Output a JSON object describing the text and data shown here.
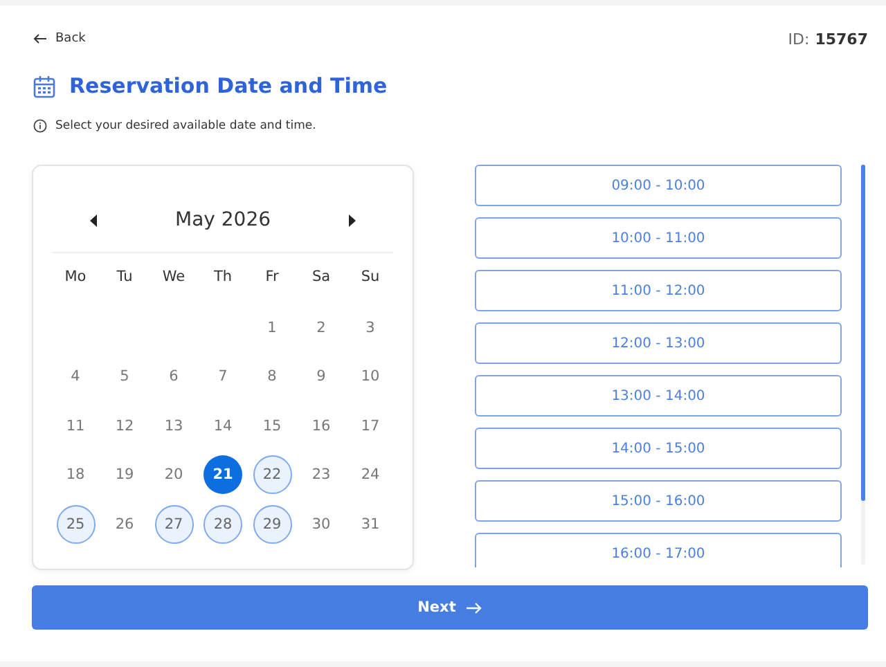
{
  "header": {
    "back": "Back",
    "id_label": "ID:",
    "id_value": "15767"
  },
  "title": "Reservation Date and Time",
  "info": "Select your desired available date and time.",
  "calendar": {
    "month": "May 2026",
    "weekdays": [
      "Mo",
      "Tu",
      "We",
      "Th",
      "Fr",
      "Sa",
      "Su"
    ],
    "weeks": [
      [
        {
          "kind": "blank"
        },
        {
          "kind": "blank"
        },
        {
          "kind": "blank"
        },
        {
          "kind": "blank"
        },
        {
          "kind": "day",
          "label": "1",
          "available": false,
          "selected": false
        },
        {
          "kind": "day",
          "label": "2",
          "available": false,
          "selected": false
        },
        {
          "kind": "day",
          "label": "3",
          "available": false,
          "selected": false
        }
      ],
      [
        {
          "kind": "day",
          "label": "4",
          "available": false,
          "selected": false
        },
        {
          "kind": "day",
          "label": "5",
          "available": false,
          "selected": false
        },
        {
          "kind": "day",
          "label": "6",
          "available": false,
          "selected": false
        },
        {
          "kind": "day",
          "label": "7",
          "available": false,
          "selected": false
        },
        {
          "kind": "day",
          "label": "8",
          "available": false,
          "selected": false
        },
        {
          "kind": "day",
          "label": "9",
          "available": false,
          "selected": false
        },
        {
          "kind": "day",
          "label": "10",
          "available": false,
          "selected": false
        }
      ],
      [
        {
          "kind": "day",
          "label": "11",
          "available": false,
          "selected": false
        },
        {
          "kind": "day",
          "label": "12",
          "available": false,
          "selected": false
        },
        {
          "kind": "day",
          "label": "13",
          "available": false,
          "selected": false
        },
        {
          "kind": "day",
          "label": "14",
          "available": false,
          "selected": false
        },
        {
          "kind": "day",
          "label": "15",
          "available": false,
          "selected": false
        },
        {
          "kind": "day",
          "label": "16",
          "available": false,
          "selected": false
        },
        {
          "kind": "day",
          "label": "17",
          "available": false,
          "selected": false
        }
      ],
      [
        {
          "kind": "day",
          "label": "18",
          "available": false,
          "selected": false
        },
        {
          "kind": "day",
          "label": "19",
          "available": false,
          "selected": false
        },
        {
          "kind": "day",
          "label": "20",
          "available": false,
          "selected": false
        },
        {
          "kind": "day",
          "label": "21",
          "available": true,
          "selected": true
        },
        {
          "kind": "day",
          "label": "22",
          "available": true,
          "selected": false
        },
        {
          "kind": "day",
          "label": "23",
          "available": false,
          "selected": false
        },
        {
          "kind": "day",
          "label": "24",
          "available": false,
          "selected": false
        }
      ],
      [
        {
          "kind": "day",
          "label": "25",
          "available": true,
          "selected": false
        },
        {
          "kind": "day",
          "label": "26",
          "available": false,
          "selected": false
        },
        {
          "kind": "day",
          "label": "27",
          "available": true,
          "selected": false
        },
        {
          "kind": "day",
          "label": "28",
          "available": true,
          "selected": false
        },
        {
          "kind": "day",
          "label": "29",
          "available": true,
          "selected": false
        },
        {
          "kind": "day",
          "label": "30",
          "available": false,
          "selected": false
        },
        {
          "kind": "day",
          "label": "31",
          "available": false,
          "selected": false
        }
      ]
    ]
  },
  "time_slots": [
    {
      "label": "09:00 - 10:00",
      "selected": false
    },
    {
      "label": "10:00 - 11:00",
      "selected": false
    },
    {
      "label": "11:00 - 12:00",
      "selected": false
    },
    {
      "label": "12:00 - 13:00",
      "selected": false
    },
    {
      "label": "13:00 - 14:00",
      "selected": false
    },
    {
      "label": "14:00 - 15:00",
      "selected": false
    },
    {
      "label": "15:00 - 16:00",
      "selected": false
    },
    {
      "label": "16:00 - 17:00",
      "selected": false
    }
  ],
  "next_button": "Next"
}
